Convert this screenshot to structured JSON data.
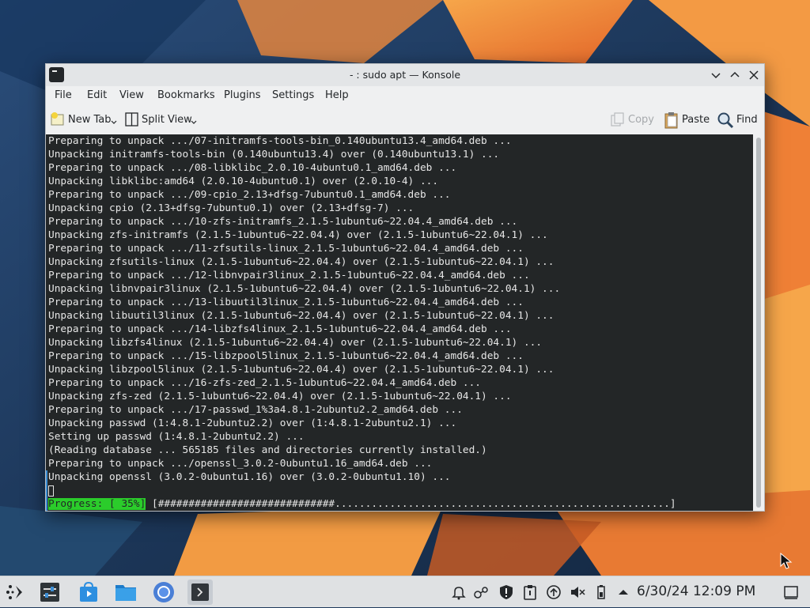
{
  "window": {
    "title": "- : sudo apt — Konsole",
    "controls": [
      "minimize",
      "maximize",
      "close"
    ]
  },
  "menubar": {
    "items": [
      "File",
      "Edit",
      "View",
      "Bookmarks",
      "Plugins",
      "Settings",
      "Help"
    ]
  },
  "toolbar": {
    "new_tab": "New Tab",
    "split_view": "Split View",
    "copy": "Copy",
    "paste": "Paste",
    "find": "Find"
  },
  "terminal": {
    "lines": [
      "Preparing to unpack .../07-initramfs-tools-bin_0.140ubuntu13.4_amd64.deb ...",
      "Unpacking initramfs-tools-bin (0.140ubuntu13.4) over (0.140ubuntu13.1) ...",
      "Preparing to unpack .../08-libklibc_2.0.10-4ubuntu0.1_amd64.deb ...",
      "Unpacking libklibc:amd64 (2.0.10-4ubuntu0.1) over (2.0.10-4) ...",
      "Preparing to unpack .../09-cpio_2.13+dfsg-7ubuntu0.1_amd64.deb ...",
      "Unpacking cpio (2.13+dfsg-7ubuntu0.1) over (2.13+dfsg-7) ...",
      "Preparing to unpack .../10-zfs-initramfs_2.1.5-1ubuntu6~22.04.4_amd64.deb ...",
      "Unpacking zfs-initramfs (2.1.5-1ubuntu6~22.04.4) over (2.1.5-1ubuntu6~22.04.1) ...",
      "Preparing to unpack .../11-zfsutils-linux_2.1.5-1ubuntu6~22.04.4_amd64.deb ...",
      "Unpacking zfsutils-linux (2.1.5-1ubuntu6~22.04.4) over (2.1.5-1ubuntu6~22.04.1) ...",
      "Preparing to unpack .../12-libnvpair3linux_2.1.5-1ubuntu6~22.04.4_amd64.deb ...",
      "Unpacking libnvpair3linux (2.1.5-1ubuntu6~22.04.4) over (2.1.5-1ubuntu6~22.04.1) ...",
      "Preparing to unpack .../13-libuutil3linux_2.1.5-1ubuntu6~22.04.4_amd64.deb ...",
      "Unpacking libuutil3linux (2.1.5-1ubuntu6~22.04.4) over (2.1.5-1ubuntu6~22.04.1) ...",
      "Preparing to unpack .../14-libzfs4linux_2.1.5-1ubuntu6~22.04.4_amd64.deb ...",
      "Unpacking libzfs4linux (2.1.5-1ubuntu6~22.04.4) over (2.1.5-1ubuntu6~22.04.1) ...",
      "Preparing to unpack .../15-libzpool5linux_2.1.5-1ubuntu6~22.04.4_amd64.deb ...",
      "Unpacking libzpool5linux (2.1.5-1ubuntu6~22.04.4) over (2.1.5-1ubuntu6~22.04.1) ...",
      "Preparing to unpack .../16-zfs-zed_2.1.5-1ubuntu6~22.04.4_amd64.deb ...",
      "Unpacking zfs-zed (2.1.5-1ubuntu6~22.04.4) over (2.1.5-1ubuntu6~22.04.1) ...",
      "Preparing to unpack .../17-passwd_1%3a4.8.1-2ubuntu2.2_amd64.deb ...",
      "Unpacking passwd (1:4.8.1-2ubuntu2.2) over (1:4.8.1-2ubuntu2.1) ...",
      "Setting up passwd (1:4.8.1-2ubuntu2.2) ...",
      "(Reading database ... 565185 files and directories currently installed.)",
      "Preparing to unpack .../openssl_3.0.2-0ubuntu1.16_amd64.deb ...",
      "Unpacking openssl (3.0.2-0ubuntu1.16) over (3.0.2-0ubuntu1.10) ..."
    ],
    "progress_label": "Progress: [ 35%]",
    "progress_bar": " [#############################.......................................................]",
    "progress_percent": 35
  },
  "taskbar": {
    "apps": [
      "app-launcher-icon",
      "system-settings-icon",
      "discover-icon",
      "file-manager-icon",
      "chromium-icon",
      "konsole-icon"
    ],
    "tray": [
      "notifications-icon",
      "kde-connect-icon",
      "security-shield-icon",
      "clipboard-icon",
      "updates-icon",
      "volume-muted-icon",
      "battery-icon",
      "tray-expand-icon"
    ],
    "clock": "6/30/24 12:09 PM",
    "show_desktop": "show-desktop-icon"
  },
  "colors": {
    "terminal_bg": "#232627",
    "terminal_fg": "#e6e6e6",
    "progress_green": "#2bcc2b",
    "window_chrome": "#eff0f1",
    "accent": "#3d8fd6"
  }
}
